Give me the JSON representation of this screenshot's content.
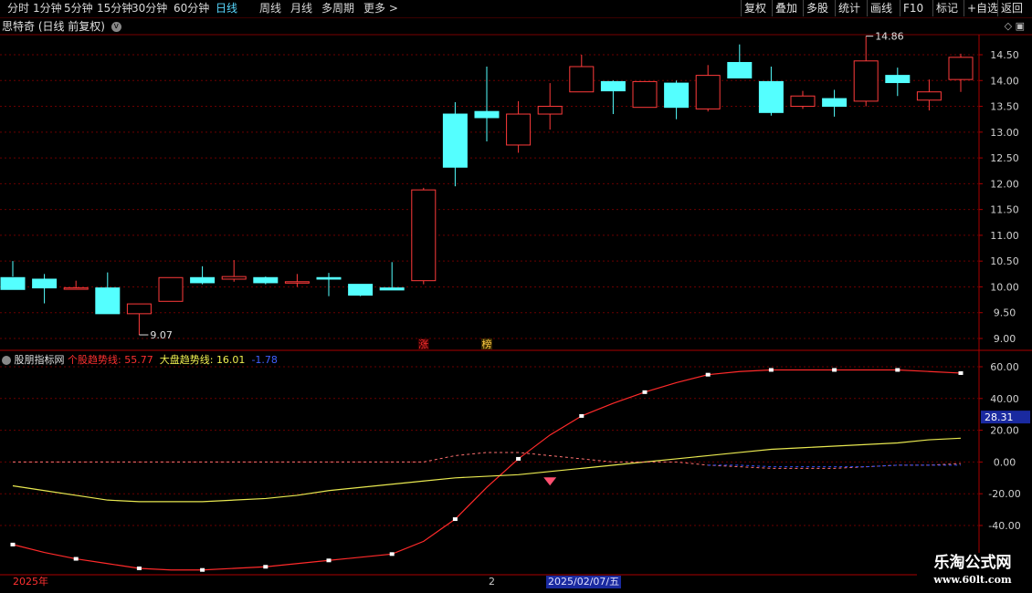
{
  "toolbar": {
    "tabs": [
      "分时",
      "1分钟",
      "5分钟",
      "15分钟",
      "30分钟",
      "60分钟",
      "日线",
      "周线",
      "月线",
      "多周期",
      "更多 >"
    ],
    "active_tab": "日线",
    "right_buttons": [
      "复权",
      "叠加",
      "多股",
      "统计",
      "画线",
      "F10",
      "标记",
      "+自选",
      "返回"
    ]
  },
  "main_chart": {
    "title": "思特奇 (日线 前复权)",
    "y_ticks": [
      "14.50",
      "14.00",
      "13.50",
      "13.00",
      "12.50",
      "12.00",
      "11.50",
      "11.00",
      "10.50",
      "10.00",
      "9.50",
      "9.00"
    ],
    "high_label": "14.86",
    "low_label": "9.07",
    "markers": [
      "涨",
      "榜"
    ],
    "up_color": "#ff3b3b",
    "down_color": "#54ffff"
  },
  "indicator": {
    "title": "股朋指标网",
    "line1_label": "个股趋势线:",
    "line1_value": "55.77",
    "line2_label": "大盘趋势线:",
    "line2_value": "16.01",
    "line3_value": "-1.78",
    "y_ticks": [
      "60.00",
      "40.00",
      "20.00",
      "0.00",
      "-20.00",
      "-40.00"
    ],
    "crosshair_value": "28.31"
  },
  "bottom_axis": {
    "year": "2025年",
    "month": "2",
    "cursor_date": "2025/02/07/五"
  },
  "watermark": {
    "line1": "乐淘公式网",
    "line2": "www.60lt.com"
  },
  "chart_data": {
    "type": "candlestick",
    "price_range": [
      8.85,
      14.95
    ],
    "candles": [
      {
        "o": 10.18,
        "h": 10.5,
        "l": 10.2,
        "c": 9.95
      },
      {
        "o": 10.15,
        "h": 10.25,
        "l": 9.68,
        "c": 9.98
      },
      {
        "o": 9.98,
        "h": 10.12,
        "l": 9.97,
        "c": 9.98
      },
      {
        "o": 9.98,
        "h": 10.28,
        "l": 9.48,
        "c": 9.48
      },
      {
        "o": 9.48,
        "h": 9.67,
        "l": 9.07,
        "c": 9.67
      },
      {
        "o": 9.72,
        "h": 10.18,
        "l": 9.72,
        "c": 10.18
      },
      {
        "o": 10.18,
        "h": 10.4,
        "l": 10.05,
        "c": 10.08
      },
      {
        "o": 10.15,
        "h": 10.52,
        "l": 10.1,
        "c": 10.2
      },
      {
        "o": 10.18,
        "h": 10.2,
        "l": 10.05,
        "c": 10.08
      },
      {
        "o": 10.1,
        "h": 10.25,
        "l": 10.0,
        "c": 10.1
      },
      {
        "o": 10.18,
        "h": 10.27,
        "l": 9.82,
        "c": 10.15
      },
      {
        "o": 10.05,
        "h": 10.05,
        "l": 9.82,
        "c": 9.84
      },
      {
        "o": 9.98,
        "h": 10.48,
        "l": 9.95,
        "c": 9.94
      },
      {
        "o": 10.12,
        "h": 11.92,
        "l": 10.05,
        "c": 11.88
      },
      {
        "o": 13.35,
        "h": 13.58,
        "l": 11.95,
        "c": 12.32
      },
      {
        "o": 13.4,
        "h": 14.27,
        "l": 12.82,
        "c": 13.28
      },
      {
        "o": 12.75,
        "h": 13.6,
        "l": 12.6,
        "c": 13.35
      },
      {
        "o": 13.35,
        "h": 13.95,
        "l": 13.05,
        "c": 13.5
      },
      {
        "o": 13.78,
        "h": 14.5,
        "l": 13.78,
        "c": 14.27
      },
      {
        "o": 13.98,
        "h": 14.0,
        "l": 13.35,
        "c": 13.8
      },
      {
        "o": 13.48,
        "h": 13.95,
        "l": 13.48,
        "c": 13.98
      },
      {
        "o": 13.95,
        "h": 14.0,
        "l": 13.25,
        "c": 13.48
      },
      {
        "o": 13.45,
        "h": 14.3,
        "l": 13.4,
        "c": 14.1
      },
      {
        "o": 14.35,
        "h": 14.7,
        "l": 14.05,
        "c": 14.05
      },
      {
        "o": 13.98,
        "h": 14.27,
        "l": 13.32,
        "c": 13.38
      },
      {
        "o": 13.5,
        "h": 13.8,
        "l": 13.45,
        "c": 13.7
      },
      {
        "o": 13.65,
        "h": 13.82,
        "l": 13.3,
        "c": 13.5
      },
      {
        "o": 13.6,
        "h": 14.86,
        "l": 13.5,
        "c": 14.38
      },
      {
        "o": 14.1,
        "h": 14.25,
        "l": 13.7,
        "c": 13.96
      },
      {
        "o": 13.62,
        "h": 14.02,
        "l": 13.42,
        "c": 13.78
      },
      {
        "o": 14.02,
        "h": 14.52,
        "l": 13.78,
        "c": 14.45
      }
    ],
    "indicator_range": [
      -70,
      68
    ],
    "series": [
      {
        "name": "个股趋势线",
        "color": "#ff2a2a",
        "values": [
          -52,
          -57,
          -61,
          -64,
          -67,
          -68,
          -68,
          -67,
          -66,
          -64,
          -62,
          -60,
          -58,
          -50,
          -36,
          -16,
          2,
          17,
          29,
          37,
          44,
          50,
          55,
          57,
          58,
          58,
          58,
          58,
          58,
          57,
          56
        ]
      },
      {
        "name": "大盘趋势线",
        "color": "#e8e850",
        "values": [
          -15,
          -18,
          -21,
          -24,
          -25,
          -25,
          -25,
          -24,
          -23,
          -21,
          -18,
          -16,
          -14,
          -12,
          -10,
          -9,
          -8,
          -6,
          -4,
          -2,
          0,
          2,
          4,
          6,
          8,
          9,
          10,
          11,
          12,
          14,
          15
        ]
      },
      {
        "name": "dashed",
        "color": "#ff7070",
        "values": [
          0,
          0,
          0,
          0,
          0,
          0,
          0,
          0,
          0,
          0,
          0,
          0,
          0,
          0,
          4,
          6,
          6,
          4,
          2,
          0,
          0,
          0,
          -2,
          -3,
          -4,
          -4,
          -4,
          -3,
          -2,
          -2,
          -1
        ]
      }
    ]
  }
}
